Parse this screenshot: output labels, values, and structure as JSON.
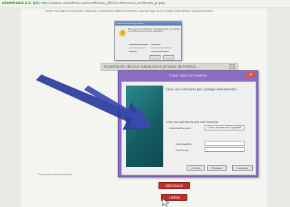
{
  "browser": {
    "ssl_label": "ABRIRMANIA S.A. (ES)",
    "url": "https://status.camerfirma.com/certificados_2015/confirmacion_certificado_pc.php"
  },
  "page": {
    "intro": "Desde esta página se procede a descargar su certificado digital Camerfirma. Cuando haga clic en el botón DESCARGAR, le aparecerá este...",
    "section_header": "Importación de una nueva clave privada de interca...",
    "side_label": "Protecc...",
    "footer_label": "Proceso de emisión mediante",
    "download_button": "DESCARGAR",
    "close_button": "CERRAR"
  },
  "warning_dialog": {
    "title": "Advertencia de seguridad",
    "text": "Está a punto de instalar un certificado desde una entidad de certificación que afirma representar:"
  },
  "dialog": {
    "title": "Crear una contraseña",
    "heading": "Crear una contraseña para proteger este elemento.",
    "subheading": "Crear una contraseña para este elemento.",
    "for_label": "Contraseña para:",
    "for_value": "Clave privada de CryptoAPI",
    "password_label": "Contraseña:",
    "confirm_label": "Confirmar:",
    "back_button": "< Atrás",
    "finish_button": "Finalizar",
    "cancel_button": "Cancelar"
  },
  "colors": {
    "dialog_frame": "#8a6dc2",
    "arrow": "#2f3f9e",
    "accent_red": "#b8322a"
  }
}
